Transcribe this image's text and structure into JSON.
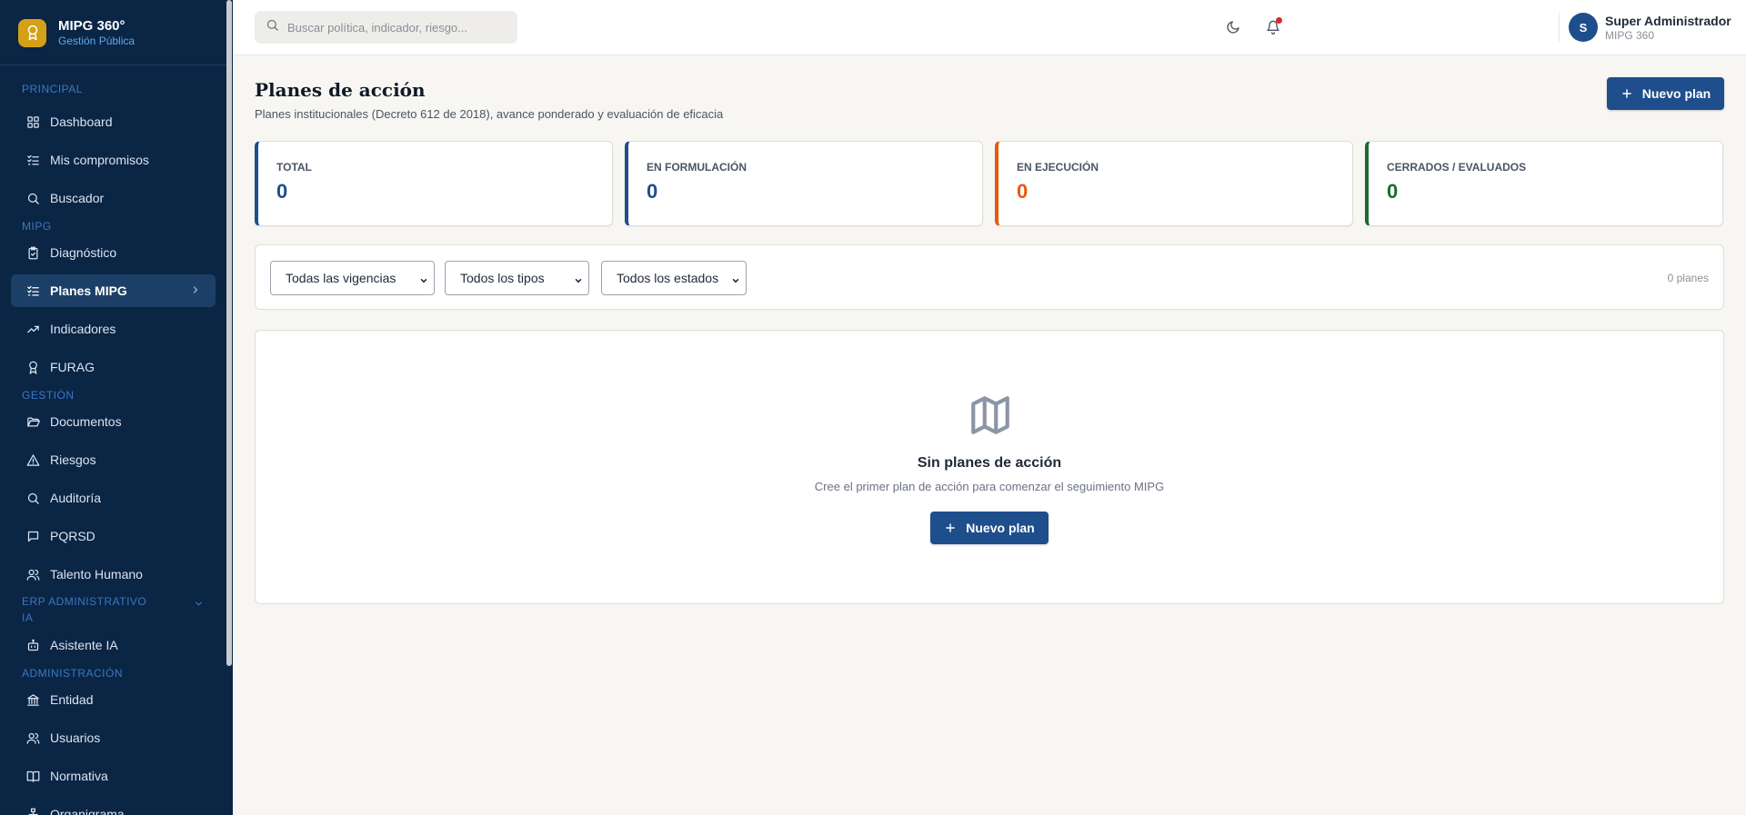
{
  "app": {
    "name": "MIPG 360°",
    "subtitle": "Gestión Pública"
  },
  "sidebar": {
    "sections": {
      "principal": "PRINCIPAL",
      "mipg": "MIPG",
      "gestion": "GESTIÓN",
      "erp": "ERP ADMINISTRATIVO",
      "ia": "IA",
      "admin": "ADMINISTRACIÓN"
    },
    "items": [
      {
        "label": "Dashboard",
        "icon": "grid-icon"
      },
      {
        "label": "Mis compromisos",
        "icon": "list-check-icon"
      },
      {
        "label": "Buscador",
        "icon": "search-icon"
      },
      {
        "label": "Diagnóstico",
        "icon": "clipboard-check-icon"
      },
      {
        "label": "Planes MIPG",
        "icon": "list-check-icon",
        "active": true
      },
      {
        "label": "Indicadores",
        "icon": "trending-up-icon"
      },
      {
        "label": "FURAG",
        "icon": "award-icon"
      },
      {
        "label": "Documentos",
        "icon": "folder-open-icon"
      },
      {
        "label": "Riesgos",
        "icon": "alert-triangle-icon"
      },
      {
        "label": "Auditoría",
        "icon": "search-icon"
      },
      {
        "label": "PQRSD",
        "icon": "message-square-icon"
      },
      {
        "label": "Talento Humano",
        "icon": "users-icon"
      },
      {
        "label": "Asistente IA",
        "icon": "bot-icon"
      },
      {
        "label": "Entidad",
        "icon": "landmark-icon"
      },
      {
        "label": "Usuarios",
        "icon": "users-icon"
      },
      {
        "label": "Normativa",
        "icon": "book-open-icon"
      },
      {
        "label": "Organigrama",
        "icon": "org-chart-icon"
      }
    ]
  },
  "topbar": {
    "search_placeholder": "Buscar política, indicador, riesgo...",
    "user": {
      "initial": "S",
      "name": "Super Administrador",
      "org": "MIPG 360"
    }
  },
  "page": {
    "title": "Planes de acción",
    "subtitle": "Planes institucionales (Decreto 612 de 2018), avance ponderado y evaluación de eficacia",
    "new_plan_label": "Nuevo plan"
  },
  "stats": [
    {
      "label": "TOTAL",
      "value": "0",
      "color": "#1e4e8c"
    },
    {
      "label": "EN FORMULACIÓN",
      "value": "0",
      "color": "#1e4e8c"
    },
    {
      "label": "EN EJECUCIÓN",
      "value": "0",
      "color": "#e8590c"
    },
    {
      "label": "CERRADOS / EVALUADOS",
      "value": "0",
      "color": "#1a6b2f"
    }
  ],
  "filters": {
    "vigencia": "Todas las vigencias",
    "tipo": "Todos los tipos",
    "estado": "Todos los estados",
    "count_label": "0 planes"
  },
  "empty_state": {
    "title": "Sin planes de acción",
    "description": "Cree el primer plan de acción para comenzar el seguimiento MIPG",
    "button_label": "Nuevo plan"
  },
  "colors": {
    "sidebar_bg": "#0b2545",
    "accent": "#1e4e8c",
    "brand_logo": "#d4a017",
    "in_progress": "#e8590c",
    "closed": "#1a6b2f"
  }
}
